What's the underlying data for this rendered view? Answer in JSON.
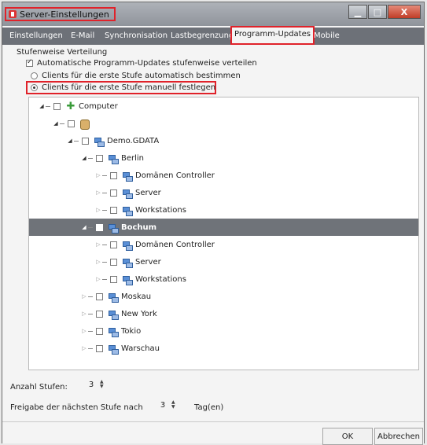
{
  "window": {
    "title": "Server-Einstellungen",
    "controls": {
      "minimize": "▁",
      "maximize": "□",
      "close": "X"
    }
  },
  "tabs": [
    {
      "label": "Einstellungen"
    },
    {
      "label": "E-Mail"
    },
    {
      "label": "Synchronisation"
    },
    {
      "label": "Lastbegrenzung"
    },
    {
      "label": "Programm-Updates",
      "active": true
    },
    {
      "label": "Mobile"
    }
  ],
  "section": {
    "title": "Stufenweise Verteilung",
    "auto_updates_label": "Automatische Programm-Updates stufenweise verteilen",
    "auto_updates_checked": true,
    "radio_auto_label": "Clients für die erste Stufe automatisch bestimmen",
    "radio_manual_label": "Clients für die erste Stufe manuell festlegen",
    "selected_radio": "manual"
  },
  "tree": [
    {
      "label": "Computer",
      "icon": "computer-icon",
      "level": 0,
      "expanded": true
    },
    {
      "label": "",
      "icon": "database-icon",
      "level": 1,
      "expanded": true
    },
    {
      "label": "Demo.GDATA",
      "icon": "network-icon",
      "level": 2,
      "expanded": true
    },
    {
      "label": "Berlin",
      "icon": "network-icon",
      "level": 3,
      "expanded": true
    },
    {
      "label": "Domänen Controller",
      "icon": "network-icon",
      "level": 4,
      "expanded": false
    },
    {
      "label": "Server",
      "icon": "network-icon",
      "level": 4,
      "expanded": false
    },
    {
      "label": "Workstations",
      "icon": "network-icon",
      "level": 4,
      "expanded": false
    },
    {
      "label": "Bochum",
      "icon": "network-icon",
      "level": 3,
      "expanded": true,
      "selected": true
    },
    {
      "label": "Domänen Controller",
      "icon": "network-icon",
      "level": 4,
      "expanded": false
    },
    {
      "label": "Server",
      "icon": "network-icon",
      "level": 4,
      "expanded": false
    },
    {
      "label": "Workstations",
      "icon": "network-icon",
      "level": 4,
      "expanded": false
    },
    {
      "label": "Moskau",
      "icon": "network-icon",
      "level": 3,
      "expanded": false
    },
    {
      "label": "New York",
      "icon": "network-icon",
      "level": 3,
      "expanded": false
    },
    {
      "label": "Tokio",
      "icon": "network-icon",
      "level": 3,
      "expanded": false
    },
    {
      "label": "Warschau",
      "icon": "network-icon",
      "level": 3,
      "expanded": false
    }
  ],
  "stages": {
    "count_label": "Anzahl Stufen:",
    "count_value": "3",
    "release_label": "Freigabe der nächsten Stufe nach",
    "release_value": "3",
    "release_unit": "Tag(en)"
  },
  "buttons": {
    "ok": "OK",
    "cancel": "Abbrechen"
  },
  "colors": {
    "highlight": "#e0222a",
    "tabbar": "#6d7178",
    "selected_row": "#6f7379"
  }
}
